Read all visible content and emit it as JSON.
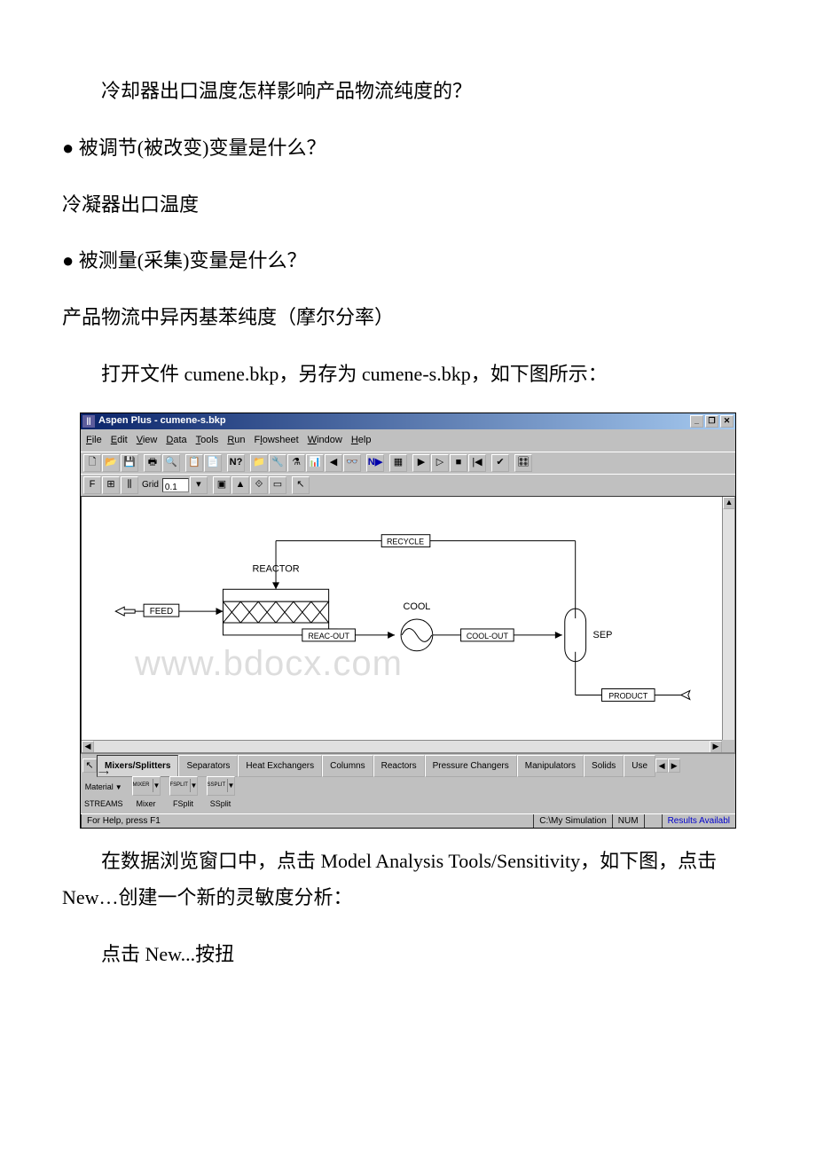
{
  "doc": {
    "p1": "冷却器出口温度怎样影响产品物流纯度的？",
    "p2": "● 被调节(被改变)变量是什么？",
    "p3": "冷凝器出口温度",
    "p4": "● 被测量(采集)变量是什么？",
    "p5": "产品物流中异丙基苯纯度（摩尔分率）",
    "p6": "打开文件 cumene.bkp，另存为 cumene-s.bkp，如下图所示：",
    "p7": "在数据浏览窗口中，点击 Model Analysis Tools/Sensitivity，如下图，点击 New…创建一个新的灵敏度分析：",
    "p8": "点击 New...按扭"
  },
  "app": {
    "title": "Aspen Plus - cumene-s.bkp",
    "menus": {
      "file": "File",
      "edit": "Edit",
      "view": "View",
      "data": "Data",
      "tools": "Tools",
      "run": "Run",
      "flowsheet": "Flowsheet",
      "window": "Window",
      "help": "Help"
    },
    "grid_label": "Grid",
    "grid_value": "0.1",
    "watermark": "www.bdocx.com",
    "flowsheet": {
      "feed": "FEED",
      "reactor": "REACTOR",
      "reac_out": "REAC-OUT",
      "cool": "COOL",
      "cool_out": "COOL-OUT",
      "recycle": "RECYCLE",
      "sep": "SEP",
      "product": "PRODUCT"
    },
    "tabs": {
      "mixers": "Mixers/Splitters",
      "separators": "Separators",
      "heatx": "Heat Exchangers",
      "columns": "Columns",
      "reactors": "Reactors",
      "pressure": "Pressure Changers",
      "manip": "Manipulators",
      "solids": "Solids",
      "user": "Use"
    },
    "palette": {
      "streams_top": "Material",
      "streams": "STREAMS",
      "mixer_box": "MIXER",
      "mixer": "Mixer",
      "fsplit_box": "FSPLIT",
      "fsplit": "FSplit",
      "ssplit_box": "SSPLIT",
      "ssplit": "SSplit"
    },
    "status": {
      "help": "For Help, press F1",
      "path": "C:\\My Simulation",
      "num": "NUM",
      "results": "Results Availabl"
    }
  }
}
